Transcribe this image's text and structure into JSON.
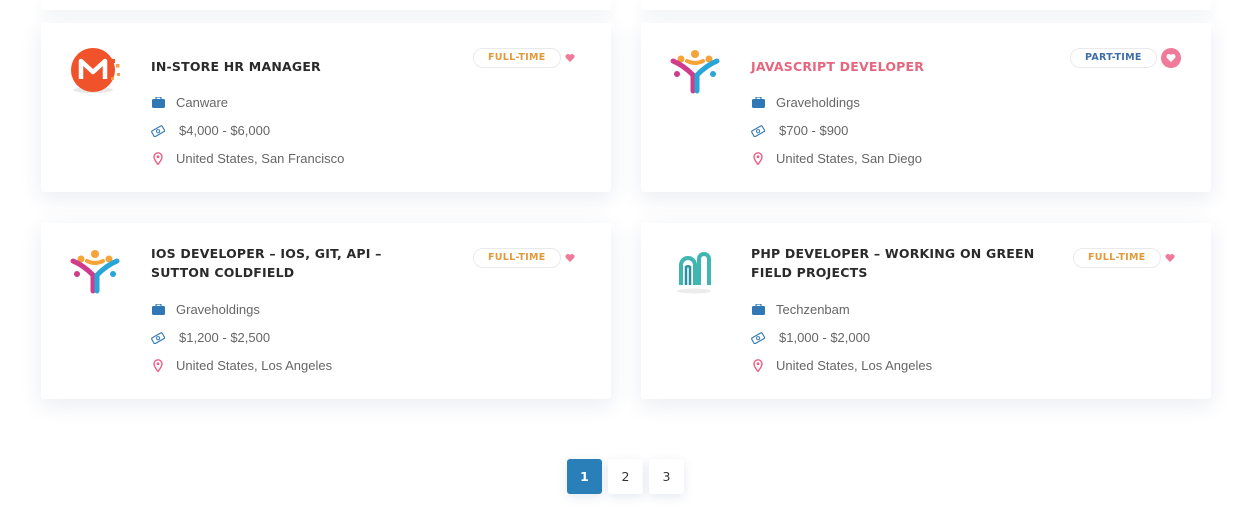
{
  "jobs": [
    {
      "title": "IN-STORE HR MANAGER",
      "type": "FULL-TIME",
      "company": "Canware",
      "salary": "$4,000 - $6,000",
      "location": "United States, San Francisco",
      "favorited": false,
      "logo": "m-logo-icon"
    },
    {
      "title": "JAVASCRIPT DEVELOPER",
      "type": "PART-TIME",
      "company": "Graveholdings",
      "salary": "$700 - $900",
      "location": "United States, San Diego",
      "favorited": true,
      "logo": "people-logo-icon"
    },
    {
      "title": "IOS DEVELOPER – IOS, GIT, API – SUTTON COLDFIELD",
      "type": "FULL-TIME",
      "company": "Graveholdings",
      "salary": "$1,200 - $2,500",
      "location": "United States, Los Angeles",
      "favorited": false,
      "logo": "people-logo-icon"
    },
    {
      "title": "PHP DEVELOPER – WORKING ON GREEN FIELD PROJECTS",
      "type": "FULL-TIME",
      "company": "Techzenbam",
      "salary": "$1,000 - $2,000",
      "location": "United States, Los Angeles",
      "favorited": false,
      "logo": "arch-logo-icon"
    }
  ],
  "pagination": {
    "pages": [
      "1",
      "2",
      "3"
    ],
    "current": "1"
  },
  "colors": {
    "accent": "#2b7fb8",
    "pink": "#e5667f",
    "full_time": "#e19a3a",
    "part_time": "#3d6fa6"
  }
}
